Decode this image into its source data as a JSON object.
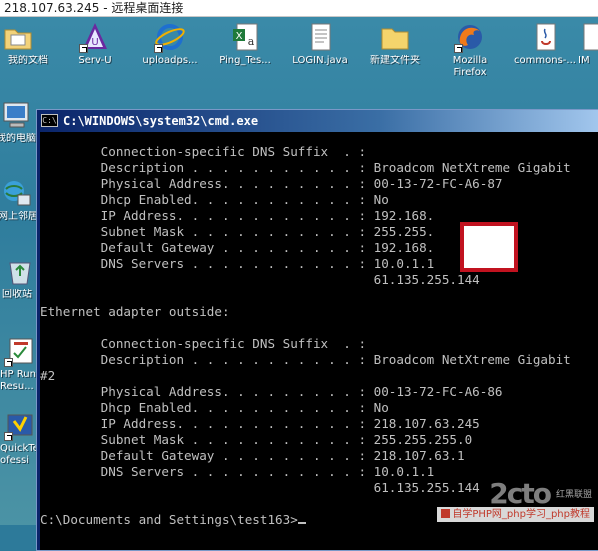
{
  "remote_desktop": {
    "title": "218.107.63.245 - 远程桌面连接"
  },
  "desktop": {
    "top_icons": [
      {
        "label": "我的文档",
        "icon": "folder-documents-icon"
      },
      {
        "label": "Serv-U",
        "icon": "serv-u-icon"
      },
      {
        "label": "uploadps...",
        "icon": "ie-icon"
      },
      {
        "label": "Ping_Tes...",
        "icon": "excel-icon"
      },
      {
        "label": "LOGIN.java",
        "icon": "text-file-icon"
      },
      {
        "label": "新建文件夹",
        "icon": "folder-icon"
      },
      {
        "label": "Mozilla Firefox",
        "icon": "firefox-icon"
      },
      {
        "label": "commons-...",
        "icon": "java-file-icon"
      },
      {
        "label": "IM",
        "icon": "file-icon"
      }
    ],
    "left_icons": [
      {
        "label": "我的电脑",
        "icon": "computer-icon"
      },
      {
        "label": "网上邻居",
        "icon": "network-icon"
      },
      {
        "label": "回收站",
        "icon": "recycle-bin-icon"
      },
      {
        "label": "HP Run",
        "label2": "Resu...",
        "icon": "hp-run-icon"
      },
      {
        "label": "QuickTe",
        "label2": "ofessi",
        "icon": "quicktest-icon"
      }
    ]
  },
  "cmd": {
    "title": "C:\\WINDOWS\\system32\\cmd.exe",
    "lines": [
      "        Connection-specific DNS Suffix  . :",
      "        Description . . . . . . . . . . . : Broadcom NetXtreme Gigabit",
      "        Physical Address. . . . . . . . . : 00-13-72-FC-A6-87",
      "        Dhcp Enabled. . . . . . . . . . . : No",
      "        IP Address. . . . . . . . . . . . : 192.168.",
      "        Subnet Mask . . . . . . . . . . . : 255.255.",
      "        Default Gateway . . . . . . . . . : 192.168.",
      "        DNS Servers . . . . . . . . . . . : 10.0.1.1",
      "                                            61.135.255.144",
      "",
      "Ethernet adapter outside:",
      "",
      "        Connection-specific DNS Suffix  . :",
      "        Description . . . . . . . . . . . : Broadcom NetXtreme Gigabit",
      "#2",
      "        Physical Address. . . . . . . . . : 00-13-72-FC-A6-86",
      "        Dhcp Enabled. . . . . . . . . . . : No",
      "        IP Address. . . . . . . . . . . . : 218.107.63.245",
      "        Subnet Mask . . . . . . . . . . . : 255.255.255.0",
      "        Default Gateway . . . . . . . . . : 218.107.63.1",
      "        DNS Servers . . . . . . . . . . . : 10.0.1.1",
      "                                            61.135.255.144",
      "",
      "C:\\Documents and Settings\\test163>"
    ]
  },
  "watermark": {
    "logo_text": "2cto",
    "logo_sub": "红黑联盟",
    "text": "自学PHP网_php学习_php教程"
  },
  "colors": {
    "console_bg": "#000000",
    "console_fg": "#c0c0c0",
    "redaction_border": "#c1121f"
  }
}
